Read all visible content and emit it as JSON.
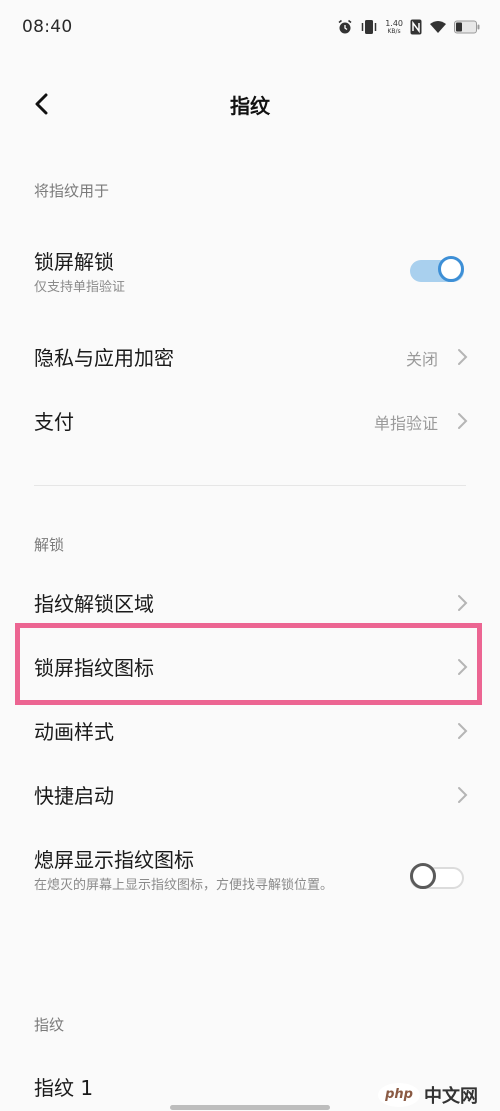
{
  "status_bar": {
    "time": "08:40",
    "net_speed_value": "1.40",
    "net_speed_unit": "KB/s",
    "icons": [
      "alarm-icon",
      "vibrate-icon",
      "nfc-icon",
      "wifi-icon",
      "battery-icon"
    ]
  },
  "header": {
    "title": "指纹",
    "back_icon": "back-arrow-icon"
  },
  "sections": {
    "use_for": {
      "header": "将指纹用于"
    },
    "unlock": {
      "header": "解锁"
    },
    "fingerprints": {
      "header": "指纹"
    }
  },
  "rows": {
    "lock_screen_unlock": {
      "title": "锁屏解锁",
      "subtitle": "仅支持单指验证",
      "toggle": true
    },
    "privacy_encryption": {
      "title": "隐私与应用加密",
      "value": "关闭"
    },
    "payment": {
      "title": "支付",
      "value": "单指验证"
    },
    "unlock_area": {
      "title": "指纹解锁区域"
    },
    "lock_screen_icon": {
      "title": "锁屏指纹图标"
    },
    "animation_style": {
      "title": "动画样式"
    },
    "quick_launch": {
      "title": "快捷启动"
    },
    "screen_off_icon": {
      "title": "熄屏显示指纹图标",
      "subtitle": "在熄灭的屏幕上显示指纹图标，方便找寻解锁位置。",
      "toggle": false
    },
    "fingerprint_1": {
      "title": "指纹 1"
    }
  },
  "watermark": {
    "logo_text": "php",
    "site_text": "中文网"
  },
  "colors": {
    "background": "#fafafa",
    "accent": "#3d8fd6",
    "highlight": "#ec6592",
    "secondary_text": "#8a8a8a"
  }
}
